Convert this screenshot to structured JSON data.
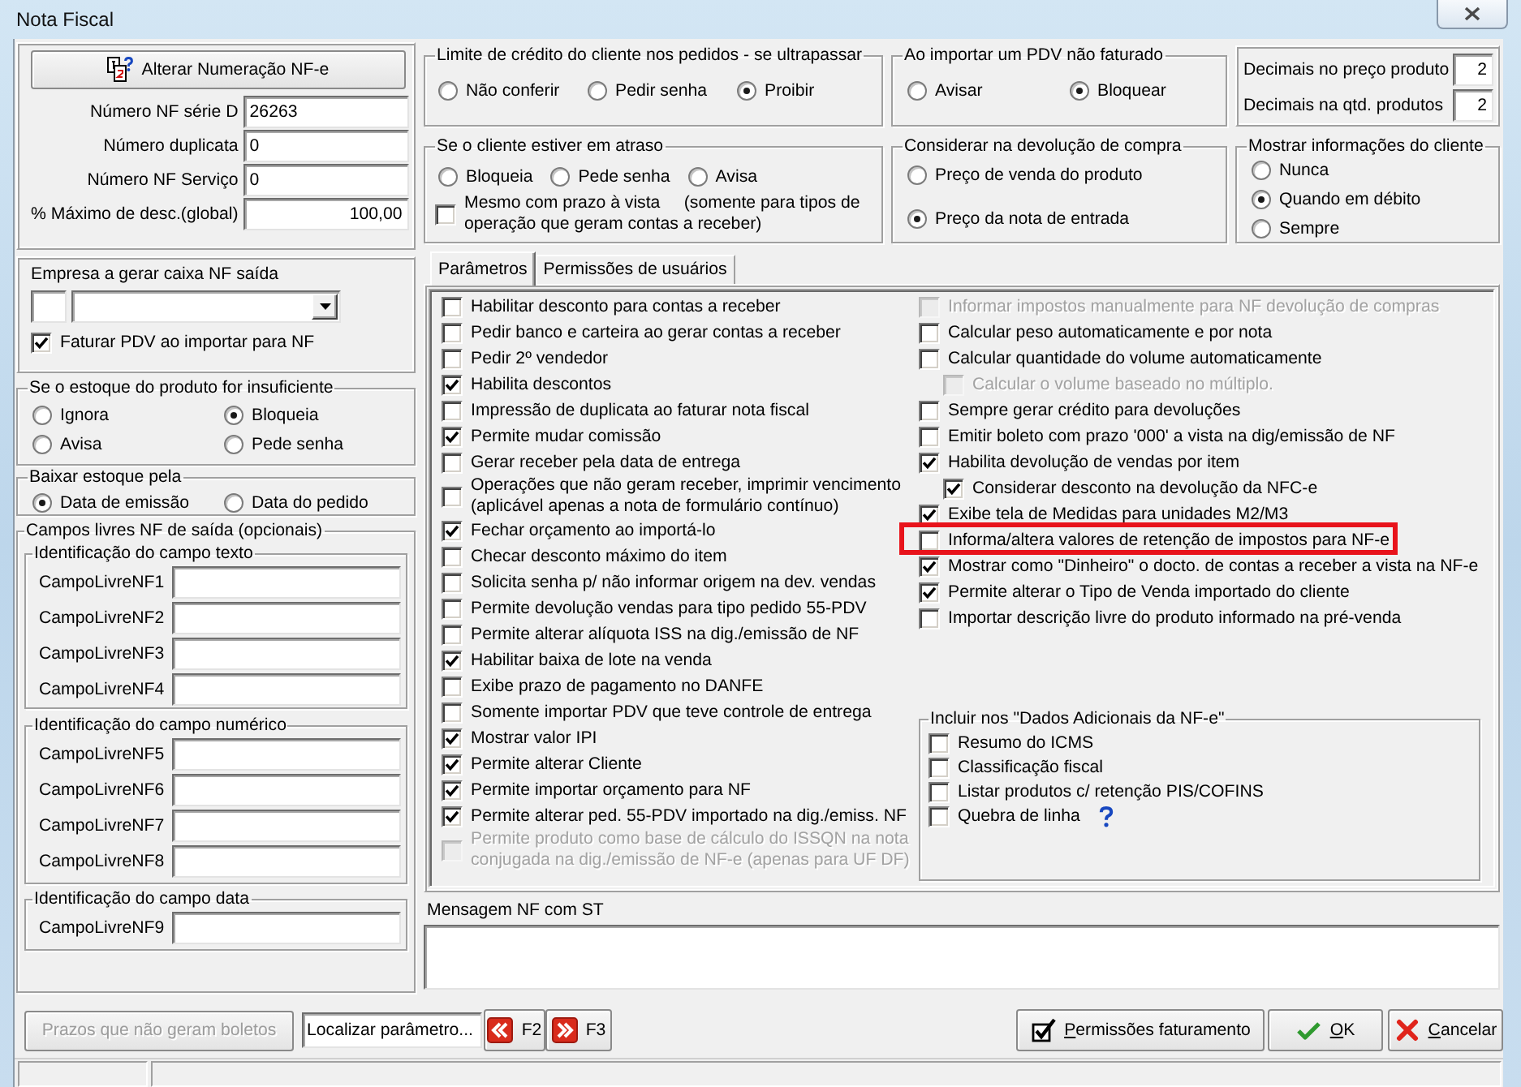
{
  "window": {
    "title": "Nota Fiscal"
  },
  "numbering": {
    "button": "Alterar Numeração NF-e",
    "fields": [
      {
        "label": "Número NF série D",
        "value": "26263",
        "kind": "plain"
      },
      {
        "label": "Número duplicata",
        "value": "0",
        "kind": "plain"
      },
      {
        "label": "Número NF Serviço",
        "value": "0",
        "kind": "plain"
      },
      {
        "label": "% Máximo de desc.(global)",
        "value": "100,00",
        "kind": "decimal"
      }
    ]
  },
  "cash_company": {
    "title": "Empresa a gerar caixa NF saída",
    "checkbox": {
      "label": "Faturar PDV ao importar para NF",
      "checked": true
    }
  },
  "insufficient_stock": {
    "title": "Se o estoque do produto for insuficiente",
    "options": [
      {
        "label": "Ignora",
        "selected": false
      },
      {
        "label": "Bloqueia",
        "selected": true
      },
      {
        "label": "Avisa",
        "selected": false
      },
      {
        "label": "Pede senha",
        "selected": false
      }
    ]
  },
  "stock_write_off": {
    "title": "Baixar estoque pela",
    "options": [
      {
        "label": "Data de emissão",
        "selected": true
      },
      {
        "label": "Data do pedido",
        "selected": false
      }
    ]
  },
  "free_fields": {
    "title": "Campos livres NF de saída (opcionais)",
    "groups": [
      {
        "title": "Identificação do campo texto",
        "fields": [
          "CampoLivreNF1",
          "CampoLivreNF2",
          "CampoLivreNF3",
          "CampoLivreNF4"
        ]
      },
      {
        "title": "Identificação do campo numérico",
        "fields": [
          "CampoLivreNF5",
          "CampoLivreNF6",
          "CampoLivreNF7",
          "CampoLivreNF8"
        ]
      },
      {
        "title": "Identificação do campo data",
        "fields": [
          "CampoLivreNF9"
        ]
      }
    ]
  },
  "credit_limit": {
    "title": "Limite de crédito do cliente nos pedidos - se ultrapassar",
    "options": [
      {
        "label": "Não conferir",
        "selected": false
      },
      {
        "label": "Pedir senha",
        "selected": false
      },
      {
        "label": "Proibir",
        "selected": true
      }
    ]
  },
  "unbilled_pdv": {
    "title": "Ao importar um PDV não faturado",
    "options": [
      {
        "label": "Avisar",
        "selected": false
      },
      {
        "label": "Bloquear",
        "selected": true
      }
    ]
  },
  "decimals": [
    {
      "label": "Decimais no preço produto",
      "value": "2"
    },
    {
      "label": "Decimais na qtd. produtos",
      "value": "2"
    }
  ],
  "overdue_client": {
    "title": "Se o cliente estiver em atraso",
    "options": [
      {
        "label": "Bloqueia",
        "selected": false
      },
      {
        "label": "Pede senha",
        "selected": false
      },
      {
        "label": "Avisa",
        "selected": false
      }
    ],
    "checkbox": {
      "label": "Mesmo com prazo à vista     (somente para tipos de\noperação que geram contas a receber)",
      "checked": false
    }
  },
  "purchase_return": {
    "title": "Considerar na devolução de compra",
    "options": [
      {
        "label": "Preço de venda do produto",
        "selected": false
      },
      {
        "label": "Preço da nota de entrada",
        "selected": true
      }
    ]
  },
  "client_info": {
    "title": "Mostrar informações do cliente",
    "options": [
      {
        "label": "Nunca",
        "selected": false
      },
      {
        "label": "Quando em débito",
        "selected": true
      },
      {
        "label": "Sempre",
        "selected": false
      }
    ]
  },
  "tabs": [
    {
      "label": "Parâmetros",
      "selected": true
    },
    {
      "label": "Permissões de usuários",
      "selected": false
    }
  ],
  "parameters": {
    "left": [
      {
        "label": "Habilitar desconto para contas a receber",
        "checked": false,
        "disabled": false
      },
      {
        "label": "Pedir banco e carteira ao gerar contas a receber",
        "checked": false,
        "disabled": false
      },
      {
        "label": "Pedir 2º vendedor",
        "checked": false,
        "disabled": false
      },
      {
        "label": "Habilita descontos",
        "checked": true,
        "disabled": false
      },
      {
        "label": "Impressão de duplicata ao faturar nota fiscal",
        "checked": false,
        "disabled": false
      },
      {
        "label": "Permite mudar comissão",
        "checked": true,
        "disabled": false
      },
      {
        "label": "Gerar receber pela data de entrega",
        "checked": false,
        "disabled": false
      },
      {
        "label": "Operações que não geram receber, imprimir vencimento\n(aplicável apenas a nota de formulário contínuo)",
        "checked": false,
        "disabled": false
      },
      {
        "label": "Fechar orçamento ao importá-lo",
        "checked": true,
        "disabled": false
      },
      {
        "label": "Checar desconto máximo do item",
        "checked": false,
        "disabled": false
      },
      {
        "label": "Solicita senha p/ não informar origem na dev. vendas",
        "checked": false,
        "disabled": false
      },
      {
        "label": "Permite devolução vendas para tipo pedido 55-PDV",
        "checked": false,
        "disabled": false
      },
      {
        "label": "Permite alterar alíquota ISS na dig./emissão de NF",
        "checked": false,
        "disabled": false
      },
      {
        "label": "Habilitar baixa de lote na venda",
        "checked": true,
        "disabled": false
      },
      {
        "label": "Exibe prazo de pagamento no DANFE",
        "checked": false,
        "disabled": false
      },
      {
        "label": "Somente importar PDV que teve controle de entrega",
        "checked": false,
        "disabled": false
      },
      {
        "label": "Mostrar valor IPI",
        "checked": true,
        "disabled": false
      },
      {
        "label": "Permite alterar Cliente",
        "checked": true,
        "disabled": false
      },
      {
        "label": "Permite importar orçamento para NF",
        "checked": true,
        "disabled": false
      },
      {
        "label": "Permite alterar ped. 55-PDV importado na dig./emiss. NF",
        "checked": true,
        "disabled": false
      },
      {
        "label": "Permite produto como base de cálculo do ISSQN na nota\nconjugada na dig./emissão de NF-e (apenas para UF DF)",
        "checked": false,
        "disabled": true
      }
    ],
    "right": [
      {
        "label": "Informar impostos manualmente para NF devolução de compras",
        "checked": false,
        "disabled": true,
        "highlighted": false
      },
      {
        "label": "Calcular peso automaticamente e por nota",
        "checked": false,
        "disabled": false,
        "highlighted": false
      },
      {
        "label": "Calcular quantidade do volume automaticamente",
        "checked": false,
        "disabled": false,
        "highlighted": false,
        "children": [
          {
            "label": "Calcular o volume baseado no múltiplo.",
            "checked": false,
            "disabled": true,
            "highlighted": false
          }
        ]
      },
      {
        "label": "Sempre gerar crédito para devoluções",
        "checked": false,
        "disabled": false,
        "highlighted": false
      },
      {
        "label": "Emitir boleto com prazo '000' a vista na dig/emissão de NF",
        "checked": false,
        "disabled": false,
        "highlighted": false
      },
      {
        "label": "Habilita devolução de vendas por item",
        "checked": true,
        "disabled": false,
        "highlighted": false,
        "children": [
          {
            "label": "Considerar desconto na devolução da NFC-e",
            "checked": true,
            "disabled": false,
            "highlighted": false
          }
        ]
      },
      {
        "label": "Exibe tela de Medidas para unidades M2/M3",
        "checked": true,
        "disabled": false,
        "highlighted": false
      },
      {
        "label": "Informa/altera valores de retenção de impostos para NF-e",
        "checked": false,
        "disabled": false,
        "highlighted": true
      },
      {
        "label": "Mostrar como \"Dinheiro\" o docto. de contas a receber a vista na NF-e",
        "checked": true,
        "disabled": false,
        "highlighted": false
      },
      {
        "label": "Permite alterar o Tipo de Venda importado do cliente",
        "checked": true,
        "disabled": false,
        "highlighted": false
      },
      {
        "label": "Importar descrição livre do produto informado na pré-venda",
        "checked": false,
        "disabled": false,
        "highlighted": false
      }
    ],
    "additional_data": {
      "title": "Incluir nos \"Dados Adicionais da NF-e\"",
      "items": [
        {
          "label": "Resumo do ICMS",
          "checked": false,
          "help": false
        },
        {
          "label": "Classificação fiscal",
          "checked": false,
          "help": false
        },
        {
          "label": "Listar produtos c/ retenção PIS/COFINS",
          "checked": false,
          "help": false
        },
        {
          "label": "Quebra de linha",
          "checked": false,
          "help": true
        }
      ]
    }
  },
  "st_message": {
    "label": "Mensagem NF com ST"
  },
  "footer": {
    "deadlines_button": {
      "label": "Prazos que não geram boletos",
      "disabled": true
    },
    "search": {
      "value": "Localizar parâmetro..."
    },
    "navigation": [
      {
        "label": "F2",
        "kind": "previous"
      },
      {
        "label": "F3",
        "kind": "next"
      }
    ],
    "actions": [
      {
        "label": "Permissões faturamento",
        "kind": "permissions"
      },
      {
        "label": "OK",
        "kind": "ok"
      },
      {
        "label": "Cancelar",
        "kind": "cancel"
      }
    ]
  }
}
